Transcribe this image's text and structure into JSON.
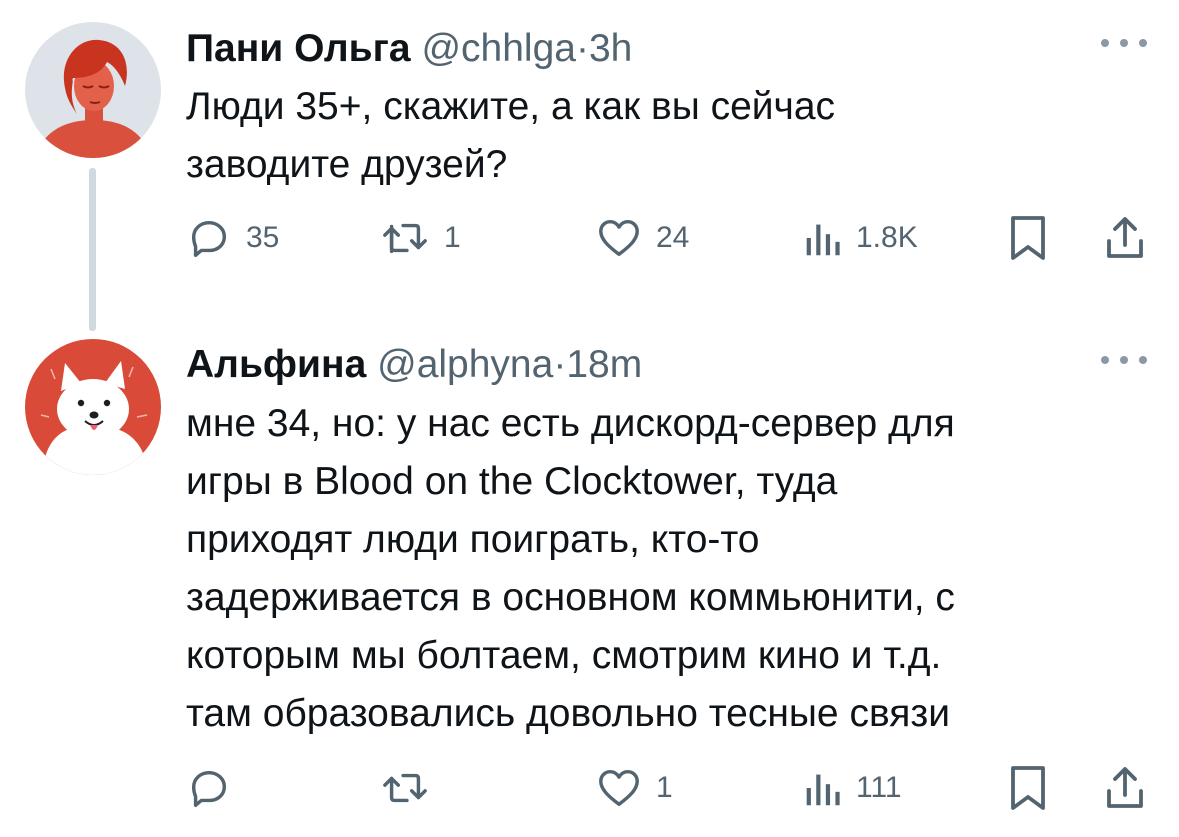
{
  "tweets": [
    {
      "display_name": "Пани Ольга",
      "handle": "@chhlga",
      "separator": "·",
      "time": "3h",
      "avatar": "red-haired-woman-avatar",
      "text_lines": [
        "Люди 35+, скажите, а как вы сейчас",
        "заводите друзей?"
      ],
      "actions": {
        "replies": "35",
        "retweets": "1",
        "likes": "24",
        "views": "1.8K"
      }
    },
    {
      "display_name": "Альфина",
      "handle": "@alphyna",
      "separator": "·",
      "time": "18m",
      "avatar": "white-dog-avatar",
      "text_lines": [
        "мне 34, но: у нас есть дискорд-сервер для",
        "игры в Blood on the Clocktower, туда",
        "приходят люди поиграть, кто-то",
        "задерживается в основном коммьюнити, с",
        "которым мы болтаем, смотрим кино и т.д.",
        "там образовались довольно тесные связи"
      ],
      "actions": {
        "replies": "",
        "retweets": "",
        "likes": "1",
        "views": "111"
      }
    }
  ],
  "icons": {
    "reply": "reply-icon",
    "retweet": "retweet-icon",
    "like": "heart-icon",
    "views": "views-icon",
    "bookmark": "bookmark-icon",
    "share": "share-icon",
    "more": "more-icon"
  },
  "colors": {
    "text": "#0f1419",
    "secondary": "#536471",
    "thread_line": "#cfd9de",
    "avatar_red": "#d94a38"
  }
}
